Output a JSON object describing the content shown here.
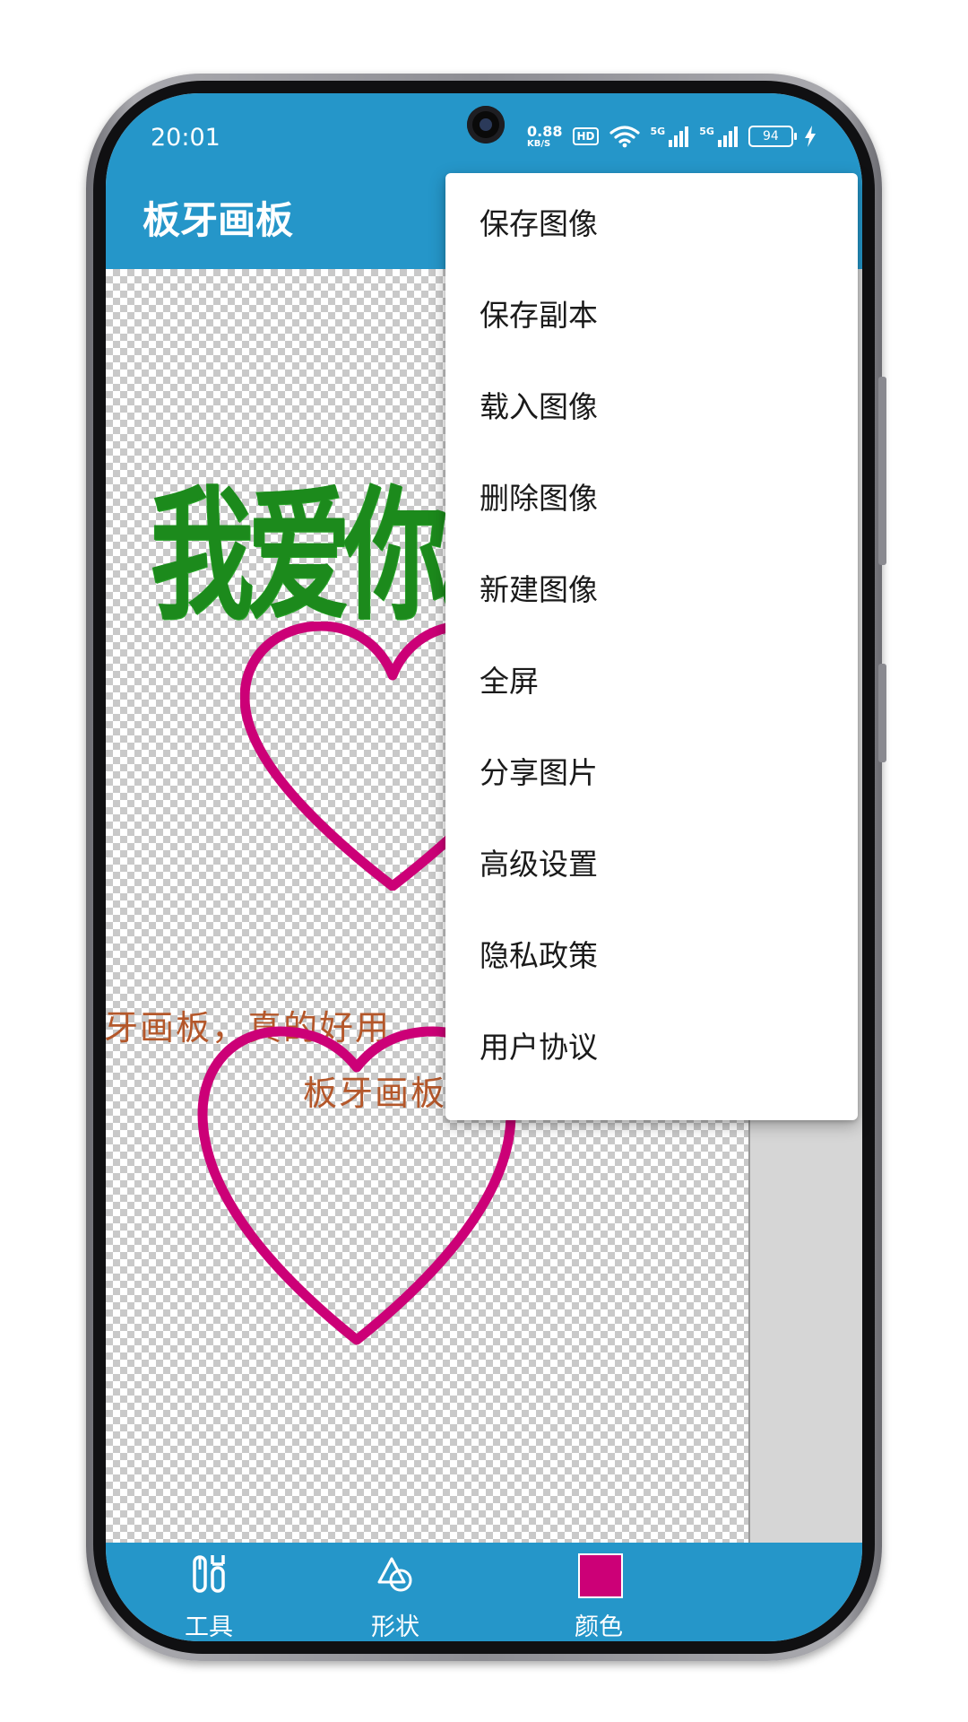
{
  "status_bar": {
    "time": "20:01",
    "network_speed": "0.88",
    "network_unit": "KB/S",
    "hd_badge": "HD",
    "signal_1": "5G",
    "signal_2": "5G",
    "battery": "94",
    "icons": [
      "wifi-icon",
      "signal-icon",
      "battery-icon",
      "charging-icon"
    ]
  },
  "app_bar": {
    "title": "板牙画板"
  },
  "canvas": {
    "big_text": "我爱你。",
    "line_1": "牙画板，真的好用",
    "line_2": "板牙画板",
    "colors": {
      "text_green": "#1c8a1c",
      "text_orange": "#b4572a",
      "heart": "#cc0077"
    }
  },
  "menu": {
    "items": [
      "保存图像",
      "保存副本",
      "载入图像",
      "删除图像",
      "新建图像",
      "全屏",
      "分享图片",
      "高级设置",
      "隐私政策",
      "用户协议"
    ]
  },
  "bottom_nav": {
    "tools": {
      "label": "工具",
      "icon": "tools-icon"
    },
    "shape": {
      "label": "形状",
      "icon": "shapes-icon"
    },
    "color": {
      "label": "颜色",
      "swatch": "#cc0077"
    }
  },
  "theme": {
    "primary": "#2596c9"
  }
}
